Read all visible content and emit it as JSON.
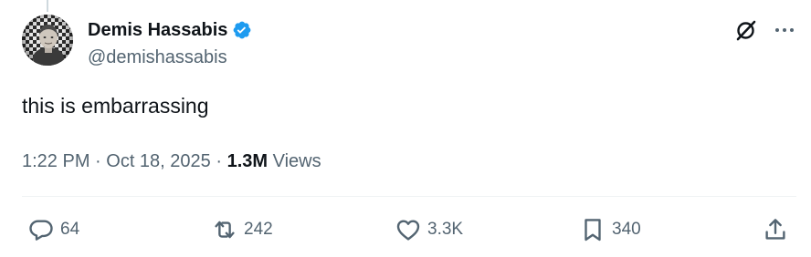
{
  "author": {
    "display_name": "Demis Hassabis",
    "handle": "@demishassabis",
    "verified": true,
    "verified_color": "#1d9bf0"
  },
  "tweet": {
    "text": "this is embarrassing",
    "time": "1:22 PM",
    "separator": " · ",
    "date": "Oct 18, 2025",
    "views_count": "1.3M",
    "views_label": "Views"
  },
  "actions": {
    "replies": "64",
    "reposts": "242",
    "likes": "3.3K",
    "bookmarks": "340"
  },
  "icons": {
    "top_right": [
      "grok-icon",
      "more-icon"
    ],
    "action_bar": [
      "reply-icon",
      "repost-icon",
      "like-icon",
      "bookmark-icon",
      "share-icon"
    ]
  },
  "colors": {
    "text_primary": "#0f1419",
    "text_secondary": "#536471",
    "divider": "#eff3f4"
  }
}
